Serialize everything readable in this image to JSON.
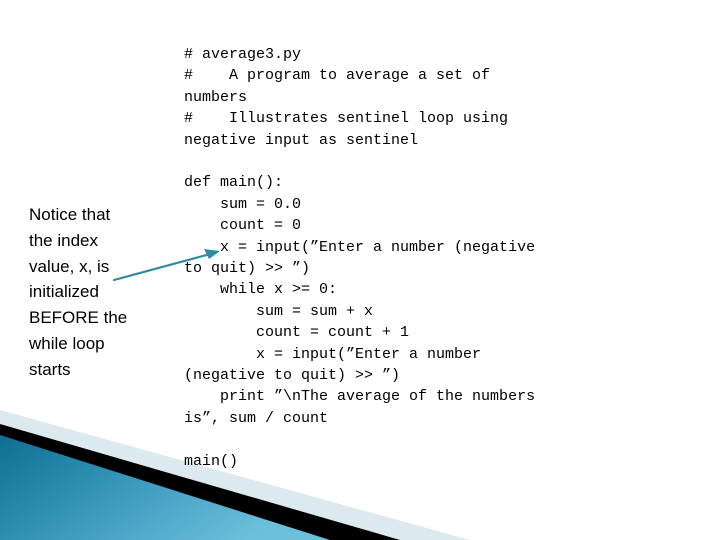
{
  "slide": {
    "background_color": "#ffffff",
    "code_text_color": "#000000",
    "accent_color": "#2e8b9e",
    "decoration": {
      "teal_dark": "#16789c",
      "teal_light": "#63b9d6",
      "black_band": "#000000",
      "pale_band": "#dce9ee"
    }
  },
  "code": {
    "lines": [
      "# average3.py",
      "#    A program to average a set of numbers",
      "#    Illustrates sentinel loop using negative input as sentinel",
      "",
      "def main():",
      "    sum = 0.0",
      "    count = 0",
      "    x = input(”Enter a number (negative to quit) >> ”)",
      "    while x >= 0:",
      "        sum = sum + x",
      "        count = count + 1",
      "        x = input(”Enter a number (negative to quit) >> ”)",
      "    print ”\\nThe average of the numbers is”, sum / count",
      "",
      "main()"
    ]
  },
  "annotation": {
    "lines": [
      "Notice that",
      "the index",
      "value, x, is",
      "initialized",
      "BEFORE the",
      "while loop",
      "starts"
    ],
    "full_text": "Notice that the index value, x, is initialized BEFORE the while loop starts"
  }
}
